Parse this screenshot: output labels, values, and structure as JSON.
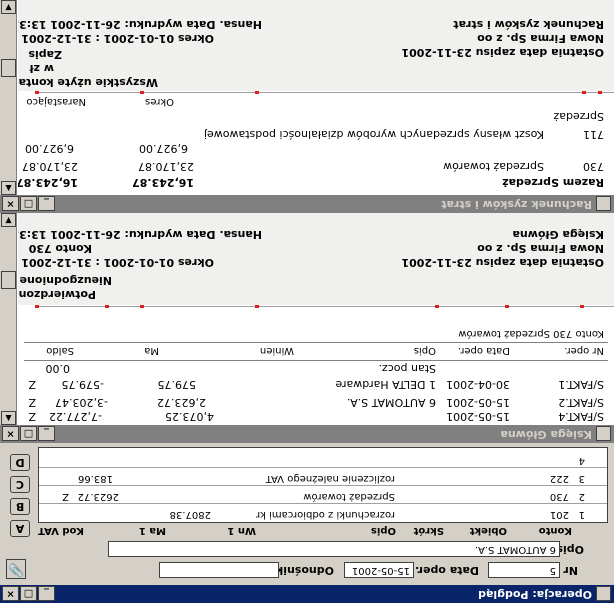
{
  "rr": {
    "title": "Rachunek zysków i strat",
    "report_name": "Rachunek zysków i strat",
    "company": "Nowa Firma Sp. z oo",
    "last_date": "Ostatnia data zapisu 23-11-2001",
    "hansa": "Hansa. Data wydruku: 26-11-2001 13:35",
    "okres": "Okres  01-01-2001 : 31-12-2001",
    "zapis": "Zapis",
    "wz": "w zł",
    "all_accounts": "Wszystkie użyte konta",
    "col_okres": "Okres",
    "col_nar": "Narastająco",
    "section": "Sprzedaż",
    "rows": [
      {
        "code": "711",
        "name": "Koszt własny sprzedanych wyrobów działalności podstawowej",
        "okres": "6,927.00",
        "nar": "6,927.00"
      },
      {
        "code": "730",
        "name": "Sprzedaż towarów",
        "okres": "23,170.87",
        "nar": "23,170.87"
      }
    ],
    "total_label": "Razem Sprzedaż",
    "total_okres": "16,243.87",
    "total_nar": "16,243.87"
  },
  "kg": {
    "title": "Księga Główna",
    "report_name": "Księga Główna",
    "company": "Nowa Firma Sp. z oo",
    "last_date": "Ostatnia data zapisu 23-11-2001",
    "hansa": "Hansa. Data wydruku: 26-11-2001 13:35",
    "okres": "Okres  01-01-2001 : 31-12-2001",
    "konto": "Konto  730",
    "nieuzg": "Nieuzgodnione",
    "potw": "Potwierdzone",
    "account_heading": "Konto 730  Sprzedaż towarów",
    "headers": [
      "Nr oper.",
      "Data oper.",
      "Opis",
      "Winien",
      "Ma",
      "Saldo"
    ],
    "stan": "Stan pocz.",
    "stan_saldo": "0.00",
    "rows": [
      {
        "nr": "S/FAKT.1",
        "data": "30-04-2001",
        "opis": "1 DELTA Hardware",
        "winien": "579.75",
        "ma": "",
        "saldo": "-579.75",
        "flag": "Z"
      },
      {
        "nr": "S/FAKT.2",
        "data": "15-05-2001",
        "opis": "6 AUTOMAT S.A.",
        "winien": "2,623.72",
        "ma": "",
        "saldo": "-3,203.47",
        "flag": "Z"
      },
      {
        "nr": "S/FAKT.4",
        "data": "15-05-2001",
        "opis": "",
        "winien": "4,073.25",
        "ma": "",
        "saldo": "-7,277.22",
        "flag": "Z"
      }
    ]
  },
  "op": {
    "title": "Operacja: Podgląd",
    "nr_label": "Nr",
    "nr_value": "5",
    "data_label": "Data oper.",
    "data_value": "15-05-2001",
    "odn_label": "Odnośnik",
    "opis_label": "Opis",
    "opis_value": "6 AUTOMAT S.A.",
    "headers": [
      "Konto",
      "Obiekt",
      "Skrót",
      "Opis",
      "Wn 1",
      "Ma 1",
      "Kod VAT"
    ],
    "rows": [
      {
        "n": "1",
        "konto": "201",
        "opis": "rozrachunki z odbiorcami kr",
        "wn": "2807.38",
        "ma": "",
        "vat": ""
      },
      {
        "n": "2",
        "konto": "730",
        "opis": "Sprzedaż towarów",
        "wn": "",
        "ma": "2623.72",
        "vat": "Z"
      },
      {
        "n": "3",
        "konto": "222",
        "opis": "rozliczenie należnego VAT",
        "wn": "",
        "ma": "183.66",
        "vat": ""
      },
      {
        "n": "4",
        "konto": "",
        "opis": "",
        "wn": "",
        "ma": "",
        "vat": ""
      }
    ],
    "tabs": [
      "A",
      "B",
      "C",
      "D"
    ]
  }
}
